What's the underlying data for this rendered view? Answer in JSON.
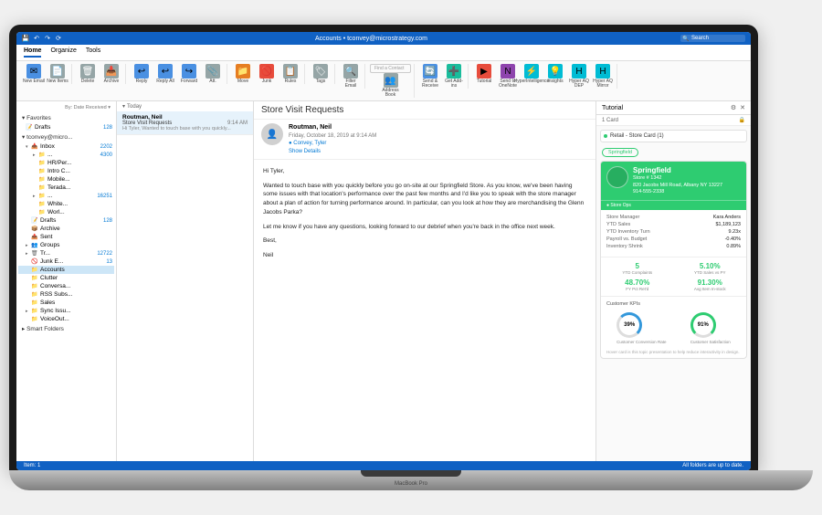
{
  "titlebar": {
    "title": "Accounts • tconvey@microstrategy.com",
    "search": "Search"
  },
  "menu": {
    "tabs": [
      "Home",
      "Organize",
      "Tools"
    ],
    "active": 0
  },
  "ribbon": [
    {
      "items": [
        {
          "icon": "✉",
          "cls": "blue",
          "label": "New Email"
        },
        {
          "icon": "📄",
          "cls": "grey",
          "label": "New Items"
        }
      ]
    },
    {
      "items": [
        {
          "icon": "🗑",
          "cls": "grey",
          "label": "Delete"
        },
        {
          "icon": "📥",
          "cls": "grey",
          "label": "Archive"
        }
      ]
    },
    {
      "items": [
        {
          "icon": "↩",
          "cls": "blue",
          "label": "Reply"
        },
        {
          "icon": "↩",
          "cls": "blue",
          "label": "Reply All"
        },
        {
          "icon": "↪",
          "cls": "blue",
          "label": "Forward"
        },
        {
          "icon": "📎",
          "cls": "grey",
          "label": "Att."
        }
      ]
    },
    {
      "items": [
        {
          "icon": "📁",
          "cls": "orange",
          "label": "Move"
        },
        {
          "icon": "🚫",
          "cls": "red",
          "label": "Junk"
        },
        {
          "icon": "📋",
          "cls": "grey",
          "label": "Rules"
        }
      ]
    },
    {
      "items": [
        {
          "icon": "🏷",
          "cls": "grey",
          "label": "Tags"
        }
      ]
    },
    {
      "items": [
        {
          "icon": "🔍",
          "cls": "grey",
          "label": "Filter Email"
        }
      ]
    },
    {
      "find": "Find a Contact",
      "items": [
        {
          "icon": "👥",
          "cls": "grey",
          "label": "Address Book"
        }
      ]
    },
    {
      "items": [
        {
          "icon": "🔄",
          "cls": "blue",
          "label": "Send & Receive"
        },
        {
          "icon": "➕",
          "cls": "teal",
          "label": "Get Add-ins"
        }
      ]
    },
    {
      "items": [
        {
          "icon": "▶",
          "cls": "red",
          "label": "Tutorial"
        },
        {
          "icon": "N",
          "cls": "purple",
          "label": "Send to OneNote"
        },
        {
          "icon": "⚡",
          "cls": "cyan",
          "label": "HyperIntelligence"
        },
        {
          "icon": "💡",
          "cls": "cyan",
          "label": "Insights"
        },
        {
          "icon": "H",
          "cls": "cyan",
          "label": "Hyper AQ DEP"
        },
        {
          "icon": "H",
          "cls": "cyan",
          "label": "Hyper AQ Mirror"
        }
      ]
    }
  ],
  "sidebar": {
    "sort_label": "By: Date Received ▾",
    "sections": [
      {
        "label": "▾ Favorites",
        "items": [
          {
            "name": "Drafts",
            "count": "128",
            "icon": "📝"
          }
        ]
      },
      {
        "label": "▾ tconvey@micro...",
        "items": [
          {
            "name": "Inbox",
            "count": "2202",
            "icon": "📥",
            "lvl": 1,
            "chev": "▾"
          },
          {
            "name": "...",
            "count": "4300",
            "icon": "📁",
            "lvl": 2,
            "chev": "▸"
          },
          {
            "name": "HR/Per...",
            "icon": "📁",
            "lvl": 2
          },
          {
            "name": "Intro C...",
            "icon": "📁",
            "lvl": 2
          },
          {
            "name": "Mobile...",
            "icon": "📁",
            "lvl": 2
          },
          {
            "name": "Terada...",
            "icon": "📁",
            "lvl": 2
          },
          {
            "name": "...",
            "count": "16251",
            "icon": "📁",
            "lvl": 2,
            "chev": "▸"
          },
          {
            "name": "White...",
            "icon": "📁",
            "lvl": 2
          },
          {
            "name": "Worl...",
            "icon": "📁",
            "lvl": 2
          },
          {
            "name": "Drafts",
            "count": "128",
            "icon": "📝",
            "lvl": 1
          },
          {
            "name": "Archive",
            "icon": "📦",
            "lvl": 1
          },
          {
            "name": "Sent",
            "icon": "📤",
            "lvl": 1
          },
          {
            "name": "Groups",
            "icon": "👥",
            "lvl": 1,
            "chev": "▸"
          },
          {
            "name": "Tr...",
            "count": "12722",
            "icon": "🗑",
            "lvl": 1,
            "chev": "▸"
          },
          {
            "name": "Junk E...",
            "count": "13",
            "icon": "🚫",
            "lvl": 1
          },
          {
            "name": "Accounts",
            "icon": "📁",
            "lvl": 1,
            "selected": true
          },
          {
            "name": "Clutter",
            "icon": "📁",
            "lvl": 1
          },
          {
            "name": "Conversa...",
            "icon": "📁",
            "lvl": 1
          },
          {
            "name": "RSS Subs...",
            "icon": "📁",
            "lvl": 1
          },
          {
            "name": "Sales",
            "icon": "📁",
            "lvl": 1
          },
          {
            "name": "Sync Issu...",
            "icon": "📁",
            "lvl": 1,
            "chev": "▸"
          },
          {
            "name": "VoiceOut...",
            "icon": "📁",
            "lvl": 1
          }
        ]
      },
      {
        "label": "▸ Smart Folders",
        "items": []
      }
    ]
  },
  "msglist": {
    "groups": [
      {
        "label": "Today",
        "items": [
          {
            "from": "Routman, Neil",
            "subject": "Store Visit Requests",
            "time": "9:14 AM",
            "preview": "Hi Tyler, Wanted to touch base with you quickly...",
            "selected": true
          }
        ]
      }
    ]
  },
  "reading": {
    "subject": "Store Visit Requests",
    "from": "Routman, Neil",
    "date": "Friday, October 18, 2019 at 9:14 AM",
    "to": "Convey, Tyler",
    "to_icon": "●",
    "details": "Show Details",
    "body": [
      "Hi Tyler,",
      "Wanted to touch base with you quickly before you go on-site at our Springfield Store. As you know, we've been having some issues with that location's performance over the past few months and I'd like you to speak with the store manager about a plan of action for turning performance around. In particular, can you look at how they are merchandising the Glenn Jacobs Parka?",
      "Let me know if you have any questions, looking forward to our debrief when you're back in the office next week.",
      "Best,",
      "Neil"
    ]
  },
  "panel": {
    "title": "Tutorial",
    "count_label": "1 Card",
    "tag": {
      "label": "Retail - Store Card (1)"
    },
    "chip": "Springfield",
    "card": {
      "name": "Springfield",
      "id": "Store # 1342",
      "address": "820 Jacobs Mill Road, Albany NY 13227",
      "phone": "914-555-2338",
      "footer_link": "● Store Ops",
      "metrics": [
        {
          "k": "Store Manager",
          "v": "Kara Anders"
        },
        {
          "k": "YTD Sales",
          "v": "$1,189,123"
        },
        {
          "k": "YTD Inventory Turn",
          "v": "9.23x"
        },
        {
          "k": "Payroll vs. Budget",
          "v": "-0.40%"
        },
        {
          "k": "Inventory Shrink",
          "v": "0.89%"
        }
      ],
      "split1": [
        {
          "big": "5",
          "sm": "YTD Complaints"
        },
        {
          "big": "5.10%",
          "sm": "YTD Sales vs PY"
        }
      ],
      "split2": [
        {
          "big": "48.70%",
          "sm": "FY Pct Ret'd"
        },
        {
          "big": "91.30%",
          "sm": "Avg Item In-stock"
        }
      ],
      "kpi_header": "Customer KPIs",
      "gauges": [
        {
          "val": "39%",
          "label": "Customer Conversion Rate"
        },
        {
          "val": "91%",
          "label": "Customer Satisfaction"
        }
      ],
      "footnote": "Hover card is this topic presentation to help reduce interactivity in design."
    }
  },
  "status": {
    "left": "Item: 1",
    "right": "All folders are up to date."
  },
  "laptop": "MacBook Pro"
}
